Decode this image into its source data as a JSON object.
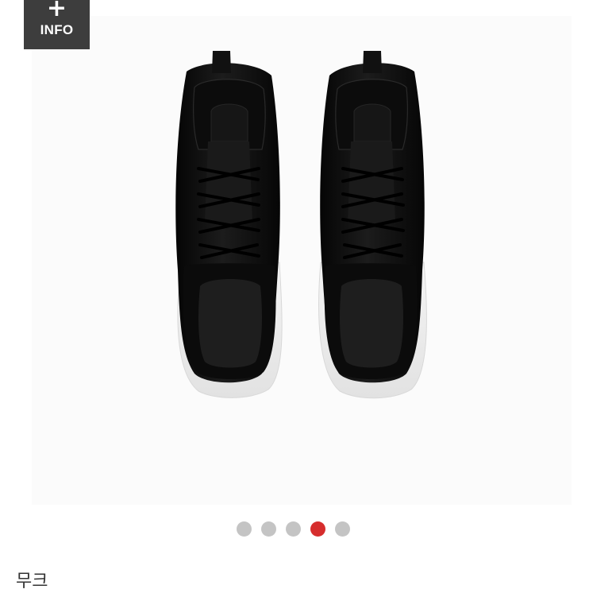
{
  "info_badge": {
    "plus": "+",
    "label": "INFO"
  },
  "product_image": {
    "subject": "black-leather-sneakers-pair"
  },
  "gallery": {
    "dot_count": 5,
    "active_index": 3,
    "active_color": "#d62d2d",
    "inactive_color": "#c4c4c4"
  },
  "product": {
    "brand": "무크"
  }
}
